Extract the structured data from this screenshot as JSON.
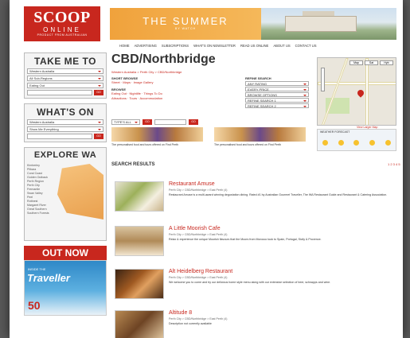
{
  "logo": {
    "name": "SCOOP",
    "sub": "ONLINE",
    "tag": "PRODUCT FROM AUSTRALIAN"
  },
  "banner": {
    "title": "THE SUMMER",
    "subtitle": "BY WATCH"
  },
  "topnav": [
    "HOME",
    "ADVERTISING",
    "SUBSCRIPTIONS",
    "WHAT'S ON NEWSLETTER",
    "READ US ONLINE",
    "ABOUT US",
    "CONTACT US"
  ],
  "sidebar": {
    "take_me_to": {
      "title": "TAKE ME TO",
      "selects": [
        "Western Australia",
        "All Sub-Regions",
        "Eating Out"
      ],
      "go": "GO"
    },
    "whats_on": {
      "title": "WHAT'S ON",
      "selects": [
        "Western Australia",
        "Show Me Everything"
      ],
      "go": "GO"
    },
    "explore": {
      "title": "EXPLORE WA",
      "regions": [
        "Kimberley",
        "Pilbara",
        "Coral Coast",
        "Golden Outback",
        "Perth Region",
        "Perth City",
        "Fremantle",
        "Swan Valley",
        "Peel",
        "Rottnest",
        "Margaret River",
        "Great Southern",
        "Southern Forests"
      ]
    },
    "outnow": {
      "title": "OUT NOW",
      "mag_pre": "INSIDE THE",
      "mag_title": "Traveller",
      "mag_num": "50"
    }
  },
  "main": {
    "title": "CBD/Northbridge",
    "breadcrumb": "Western Australia > Perth City > CBD/Northbridge",
    "shortbrowse_label": "SHORT BROWSE",
    "shortbrowse_links": "Street · Maps · Image Gallery",
    "browse_label": "BROWSE",
    "browse_links": [
      "Eating Out · Nightlife · Things To Do",
      "Attractions · Tours · Accommodation"
    ],
    "refine": {
      "label": "REFINE SEARCH",
      "selects": [
        "ANY RATING",
        "EVERY PRICE",
        "BROWSE OPTIONS",
        "REFINE SEARCH 1",
        "REFINE SEARCH 2"
      ]
    },
    "search_select": "TYPE'S ALL",
    "go": "GO",
    "promos": [
      "The personalised food and tours offered on Find Perth",
      "The personalised food and tours offered on Find Perth"
    ]
  },
  "map": {
    "buttons": [
      "Map",
      "Sat",
      "Hyb"
    ],
    "view_link": "View Larger Map"
  },
  "weather": {
    "title": "WEATHER FORECAST"
  },
  "results": {
    "heading": "SEARCH RESULTS",
    "pages": "1 2 3 4 5",
    "items": [
      {
        "title": "Restaurant Amuse",
        "location": "Perth City > CBD/Northbridge > East Perth (4)",
        "desc": "Restaurant Amuse is a multi-award winning degustation dining. Rated #1 by Australian Gourmet Traveller, The WA Restaurant Guide and Restaurant & Catering Association."
      },
      {
        "title": "A Little Moorish Cafe",
        "location": "Perth City > CBD/Northbridge > East Perth (4)",
        "desc": "Relax & experience the unique Moorish flavours that the Moors from Morocco took to Spain, Portugal, Sicily & Provence."
      },
      {
        "title": "Alt Heidelberg Restaurant",
        "location": "Perth City > CBD/Northbridge > East Perth (4)",
        "desc": "We welcome you to come and try our delicious home style menu along with our extensive selection of beer, schnapps and wine."
      },
      {
        "title": "Altitude 8",
        "location": "Perth City > CBD/Northbridge > East Perth (4)",
        "desc": "Description not currently available"
      }
    ]
  }
}
